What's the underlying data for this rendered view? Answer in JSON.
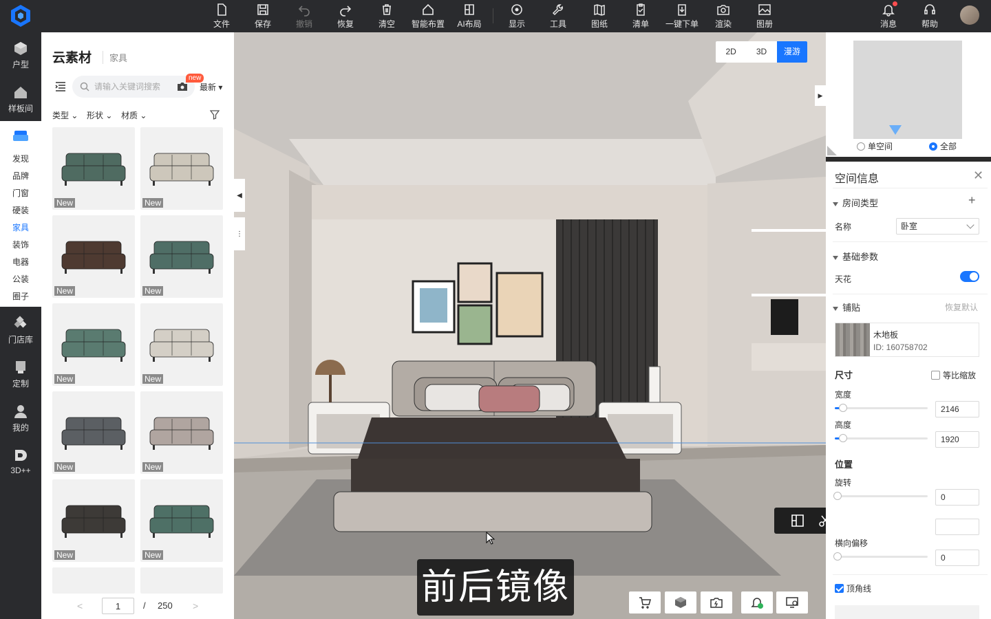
{
  "toolbar": {
    "buttons": [
      {
        "label": "文件",
        "icon": "file-icon"
      },
      {
        "label": "保存",
        "icon": "save-icon"
      },
      {
        "label": "撤销",
        "icon": "undo-icon"
      },
      {
        "label": "恢复",
        "icon": "redo-icon"
      },
      {
        "label": "清空",
        "icon": "trash-icon"
      },
      {
        "label": "智能布置",
        "icon": "home-icon"
      },
      {
        "label": "AI布局",
        "icon": "layout-icon"
      },
      {
        "label": "显示",
        "icon": "eye-icon"
      },
      {
        "label": "工具",
        "icon": "wrench-icon"
      },
      {
        "label": "图纸",
        "icon": "map-icon"
      },
      {
        "label": "清单",
        "icon": "clipboard-icon"
      },
      {
        "label": "一键下单",
        "icon": "download-icon"
      },
      {
        "label": "渲染",
        "icon": "camera-icon"
      },
      {
        "label": "图册",
        "icon": "image-icon"
      }
    ],
    "messages_label": "消息",
    "help_label": "帮助"
  },
  "leftnav": {
    "items": [
      {
        "label": "户型",
        "icon": "cube-icon"
      },
      {
        "label": "样板间",
        "icon": "house-icon"
      },
      {
        "label": "门店库",
        "icon": "store-icon"
      },
      {
        "label": "定制",
        "icon": "custom-icon"
      },
      {
        "label": "我的",
        "icon": "user-icon"
      },
      {
        "label": "3D++",
        "icon": "3d-plus-icon"
      }
    ],
    "cloud_icon": "sofa-icon",
    "sub_items": [
      "发现",
      "品牌",
      "门窗",
      "硬装",
      "家具",
      "装饰",
      "电器",
      "公装",
      "圈子"
    ],
    "active_sub": "家具"
  },
  "panel": {
    "title": "云素材",
    "subtitle": "家具",
    "search_placeholder": "请输入关键词搜索",
    "new_tag": "new",
    "sort_label": "最新",
    "filters": [
      "类型",
      "形状",
      "材质"
    ],
    "badge": "New",
    "products": [
      {
        "color": "#4f6b61"
      },
      {
        "color": "#cdc7bb"
      },
      {
        "color": "#4e3a31"
      },
      {
        "color": "#4f6e66"
      },
      {
        "color": "#5a7b70"
      },
      {
        "color": "#d4cfc6"
      },
      {
        "color": "#5b5f63"
      },
      {
        "color": "#b0a5a0"
      },
      {
        "color": "#3d3a37"
      },
      {
        "color": "#4e7066"
      }
    ],
    "page": {
      "current": "1",
      "separator": "/",
      "total": "250",
      "prev": "<",
      "next": ">"
    }
  },
  "viewport": {
    "views": [
      "2D",
      "3D",
      "漫游"
    ],
    "active_view": "漫游",
    "caption": "前后镜像",
    "bottom_icons": [
      "cart-icon",
      "box-icon",
      "camera-refresh-icon",
      "bell-check-icon",
      "monitor-icon"
    ],
    "float_icons": [
      "replace-icon",
      "cut-icon",
      "mirror-icon",
      "link-icon",
      "align-icon",
      "star-icon"
    ]
  },
  "minimap": {
    "options": [
      "单空间",
      "全部"
    ],
    "selected": "全部"
  },
  "props": {
    "title": "空间信息",
    "sec_room": "房间类型",
    "name_label": "名称",
    "name_value": "卧室",
    "sec_basic": "基础参数",
    "ceiling_label": "天花",
    "ceiling_on": true,
    "sec_tile": "铺贴",
    "restore_label": "恢复默认",
    "material_name": "木地板",
    "material_id": "ID: 160758702",
    "size_label": "尺寸",
    "proportional_label": "等比缩放",
    "width_label": "宽度",
    "width_value": "2146",
    "height_label": "高度",
    "height_value": "1920",
    "position_label": "位置",
    "rotate_label": "旋转",
    "rotate_value": "0",
    "offset_label": "横向偏移",
    "offset_value": "0",
    "cornice_label": "顶角线",
    "cornice_on": true
  }
}
